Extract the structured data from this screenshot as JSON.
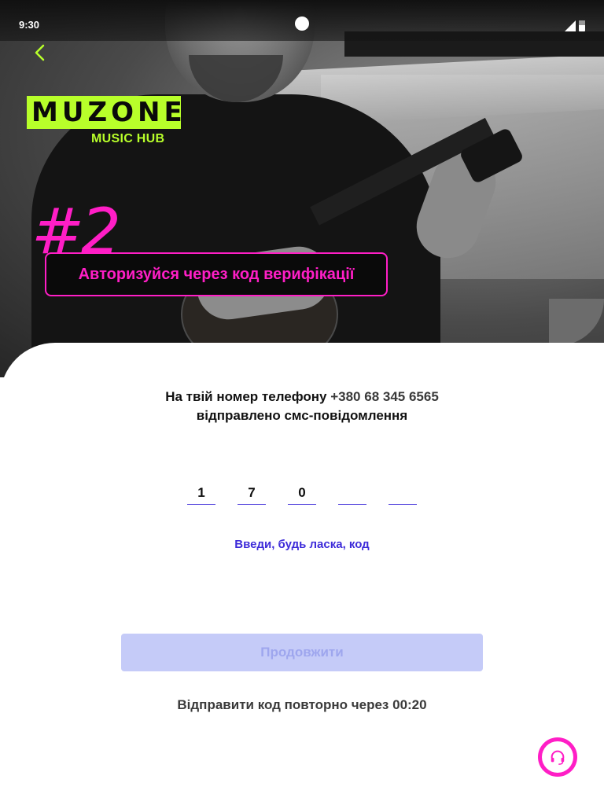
{
  "status_bar": {
    "time": "9:30"
  },
  "logo": {
    "wordmark": "MUZONE",
    "subtitle": "MUSIC HUB"
  },
  "step": {
    "number": "#2",
    "title": "Авторизуйся через код верифікації"
  },
  "info": {
    "line1_prefix": "На твій номер телефону ",
    "phone": "+380 68 345 6565",
    "line2": "відправлено смс-повідомлення"
  },
  "otp": {
    "digits": [
      "1",
      "7",
      "0",
      "",
      ""
    ]
  },
  "hint": "Введи, будь ласка, код",
  "continue_label": "Продовжити",
  "resend": "Відправити код повторно через 00:20",
  "colors": {
    "accent": "#3d2bd9",
    "pink": "#ff1ec6",
    "lime": "#b8ff2a",
    "button_disabled_bg": "#c5cbf8"
  },
  "icons": {
    "back": "chevron-left-icon",
    "support": "headset-icon"
  }
}
